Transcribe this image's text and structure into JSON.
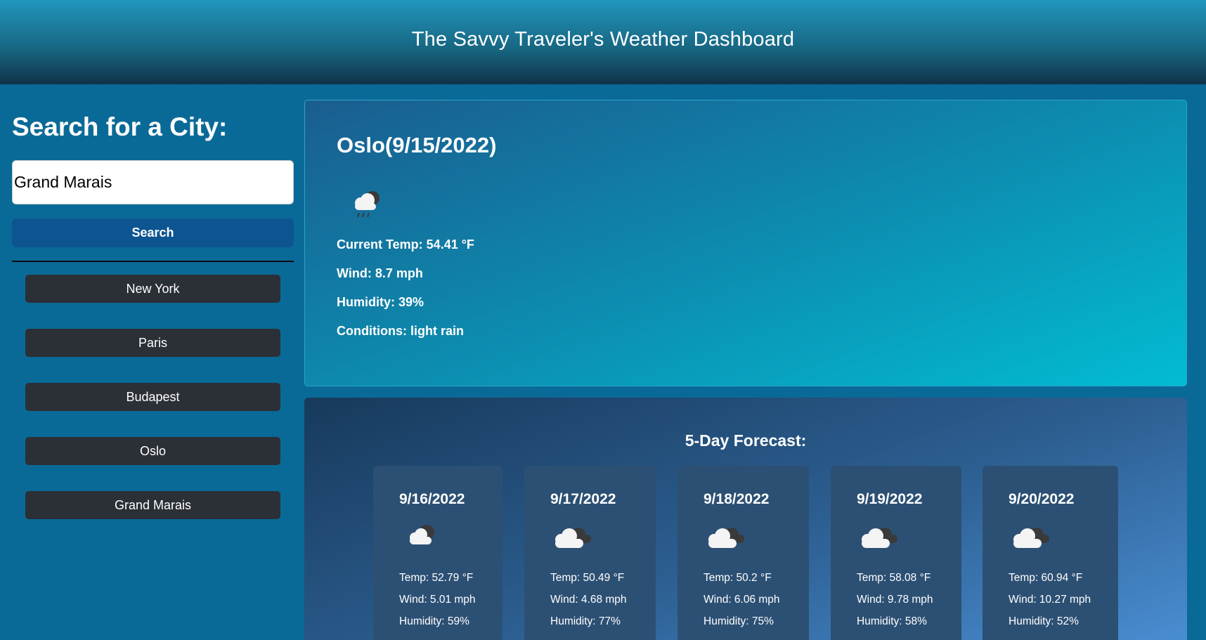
{
  "header": {
    "title": "The Savvy Traveler's Weather Dashboard"
  },
  "sidebar": {
    "heading": "Search for a City:",
    "search_value": "Grand Marais",
    "search_button": "Search",
    "history": [
      "New York",
      "Paris",
      "Budapest",
      "Oslo",
      "Grand Marais"
    ]
  },
  "current": {
    "title": "Oslo(9/15/2022)",
    "icon": "cloud-rain-icon",
    "temp": "Current Temp: 54.41 °F",
    "wind": "Wind: 8.7 mph",
    "humidity": "Humidity: 39%",
    "conditions": "Conditions: light rain"
  },
  "forecast": {
    "heading": "5-Day Forecast:",
    "days": [
      {
        "date": "9/16/2022",
        "icon": "cloud-icon",
        "temp": "Temp: 52.79 °F",
        "wind": "Wind: 5.01 mph",
        "humidity": "Humidity: 59%"
      },
      {
        "date": "9/17/2022",
        "icon": "clouds-icon",
        "temp": "Temp: 50.49 °F",
        "wind": "Wind: 4.68 mph",
        "humidity": "Humidity: 77%"
      },
      {
        "date": "9/18/2022",
        "icon": "clouds-icon",
        "temp": "Temp: 50.2 °F",
        "wind": "Wind: 6.06 mph",
        "humidity": "Humidity: 75%"
      },
      {
        "date": "9/19/2022",
        "icon": "clouds-icon",
        "temp": "Temp: 58.08 °F",
        "wind": "Wind: 9.78 mph",
        "humidity": "Humidity: 58%"
      },
      {
        "date": "9/20/2022",
        "icon": "clouds-icon",
        "temp": "Temp: 60.94 °F",
        "wind": "Wind: 10.27 mph",
        "humidity": "Humidity: 52%"
      }
    ]
  }
}
